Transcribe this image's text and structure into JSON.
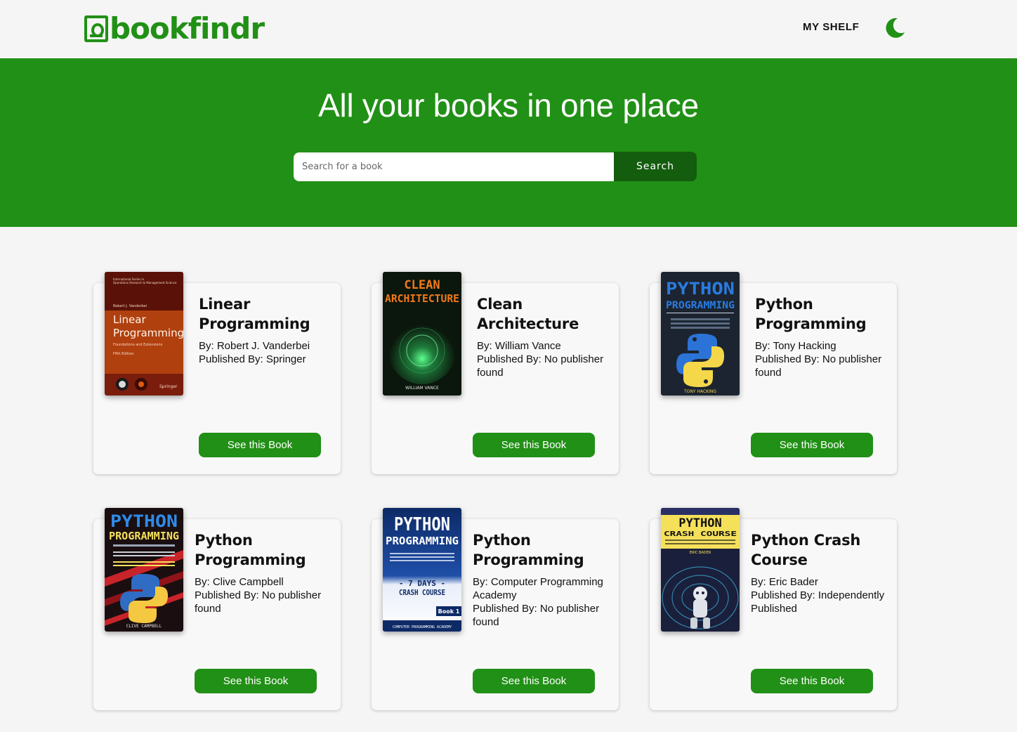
{
  "brand": {
    "name": "bookfindr",
    "color": "#219016"
  },
  "nav": {
    "my_shelf": "MY SHELF",
    "theme_icon": "moon-icon"
  },
  "hero": {
    "title": "All your books in one place",
    "search_placeholder": "Search for a book",
    "search_button": "Search"
  },
  "books": [
    {
      "title": "Linear Programming",
      "by": "By: Robert J. Vanderbei",
      "published": "Published By: Springer",
      "button": "See this Book"
    },
    {
      "title": "Clean Architecture",
      "by": "By: William Vance",
      "published": "Published By: No publisher found",
      "button": "See this Book"
    },
    {
      "title": "Python Programming",
      "by": "By: Tony Hacking",
      "published": "Published By: No publisher found",
      "button": "See this Book"
    },
    {
      "title": "Python Programming",
      "by": "By: Clive Campbell",
      "published": "Published By: No publisher found",
      "button": "See this Book"
    },
    {
      "title": "Python Programming",
      "by": "By: Computer Programming Academy",
      "published": "Published By: No publisher found",
      "button": "See this Book"
    },
    {
      "title": "Python Crash Course",
      "by": "By: Eric Bader",
      "published": "Published By: Independently Published",
      "button": "See this Book"
    }
  ],
  "covers": [
    {
      "lines": [
        "Linear",
        "Programming"
      ],
      "author": "Robert J. Vanderbei",
      "tagline": "Foundations and Extensions",
      "edition": "Fifth Edition",
      "publisher": "Springer",
      "bg": "#7a1d0c",
      "accent": "#c8490f"
    },
    {
      "lines": [
        "CLEAN",
        "ARCHITECTURE"
      ],
      "author": "WILLIAM VANCE",
      "bg": "#0b160c",
      "accent": "#2fd06b"
    },
    {
      "lines": [
        "PYTHON",
        "PROGRAMMING"
      ],
      "author": "TONY HACKING",
      "bg": "#1b2430",
      "accent": "#2a7be0"
    },
    {
      "lines": [
        "PYTHON",
        "PROGRAMMING"
      ],
      "author": "CLIVE CAMPBELL",
      "bg": "#1a0e10",
      "accent": "#c8242a"
    },
    {
      "lines": [
        "PYTHON",
        "PROGRAMMING"
      ],
      "author": "COMPUTER PROGRAMMING ACADEMY",
      "subtitle": "- 7 DAYS -",
      "subtitle2": "CRASH COURSE",
      "badge": "Book 1",
      "bg": "#0e2a66",
      "accent": "#e8eef9"
    },
    {
      "lines": [
        "PYTHON",
        "CRASH COURSE"
      ],
      "author": "ERIC BADER",
      "bg": "#1a1f3b",
      "accent": "#f5e05a"
    }
  ]
}
